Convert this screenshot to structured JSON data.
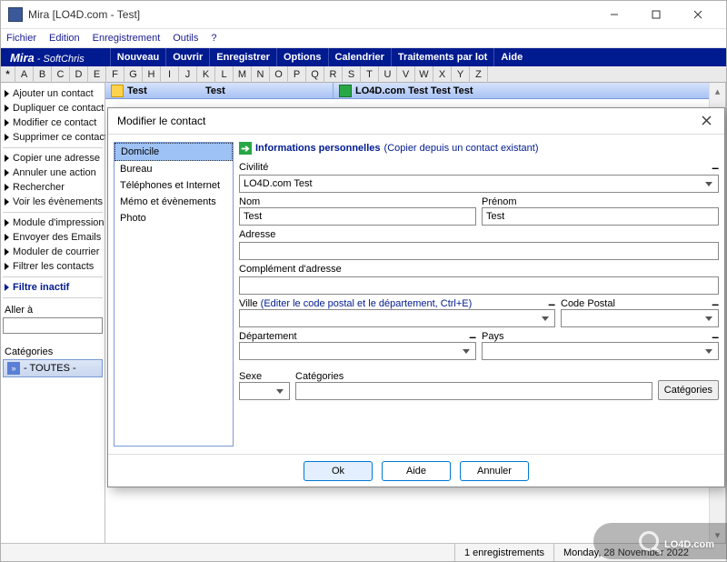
{
  "window": {
    "title": "Mira [LO4D.com - Test]"
  },
  "menubar": [
    "Fichier",
    "Edition",
    "Enregistrement",
    "Outils",
    "?"
  ],
  "brand": {
    "name": "Mira",
    "sub": " - SoftChris"
  },
  "toolbar": [
    "Nouveau",
    "Ouvrir",
    "Enregistrer",
    "Options",
    "Calendrier",
    "Traitements par lot",
    "Aide"
  ],
  "alphabet": [
    "*",
    "A",
    "B",
    "C",
    "D",
    "E",
    "F",
    "G",
    "H",
    "I",
    "J",
    "K",
    "L",
    "M",
    "N",
    "O",
    "P",
    "Q",
    "R",
    "S",
    "T",
    "U",
    "V",
    "W",
    "X",
    "Y",
    "Z"
  ],
  "sidebar": {
    "items": [
      "Ajouter un contact",
      "Dupliquer ce contact",
      "Modifier ce contact",
      "Supprimer ce contact"
    ],
    "items2": [
      "Copier une adresse",
      "Annuler une action",
      "Rechercher",
      "Voir les évènements"
    ],
    "items3": [
      "Module d'impression",
      "Envoyer des Emails",
      "Moduler de courrier",
      "Filtrer les contacts"
    ],
    "filter_inactive": "Filtre inactif",
    "goto_label": "Aller à",
    "cat_label": "Catégories",
    "cat_value": "- TOUTES -"
  },
  "list": {
    "header_col1a": "Test",
    "header_col1b": "Test",
    "header_col2": "LO4D.com Test Test  Test"
  },
  "statusbar": {
    "count": "1 enregistrements",
    "date": "Monday, 28 November 2022"
  },
  "dialog": {
    "title": "Modifier le contact",
    "tabs": [
      "Domicile",
      "Bureau",
      "Téléphones et Internet",
      "Mémo et évènements",
      "Photo"
    ],
    "section_title": "Informations personnelles",
    "section_link": "(Copier depuis un contact existant)",
    "labels": {
      "civilite": "Civilité",
      "nom": "Nom",
      "prenom": "Prénom",
      "adresse": "Adresse",
      "complement": "Complément d'adresse",
      "ville": "Ville",
      "ville_link": "(Editer le code postal et le département, Ctrl+E)",
      "cp": "Code Postal",
      "dept": "Département",
      "pays": "Pays",
      "sexe": "Sexe",
      "categories": "Catégories"
    },
    "values": {
      "civilite": "LO4D.com Test",
      "nom": "Test",
      "prenom": "Test",
      "adresse": "",
      "complement": "",
      "ville": "",
      "cp": "",
      "dept": "",
      "pays": "",
      "sexe": "",
      "categories": ""
    },
    "buttons": {
      "cat": "Catégories",
      "ok": "Ok",
      "help": "Aide",
      "cancel": "Annuler"
    }
  },
  "watermark": "LO4D.com"
}
